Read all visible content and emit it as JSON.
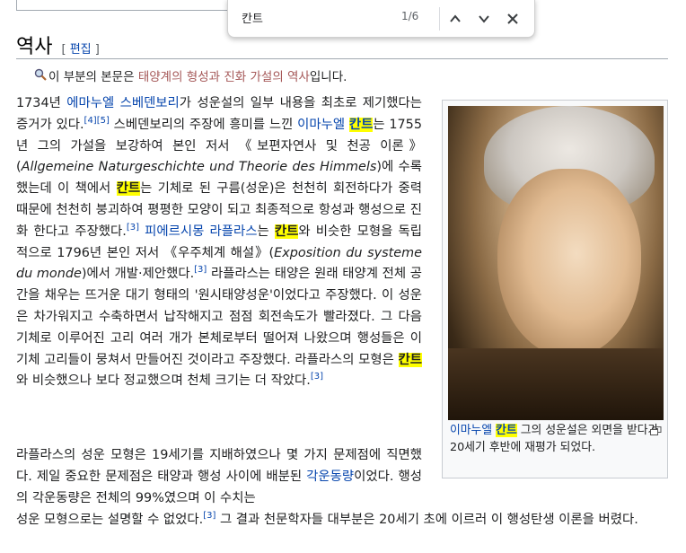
{
  "heading": {
    "title": "역사",
    "edit_open": "[ ",
    "edit_label": "편집",
    "edit_close": " ]"
  },
  "hatnote": {
    "pre": "이 부분의 본문은 ",
    "link": "태양계의 형성과 진화 가설의 역사",
    "post": "입니다."
  },
  "find": {
    "query": "칸트",
    "count": "1/6"
  },
  "thumb": {
    "cap_pre": "이마누엘 ",
    "cap_hl": "칸트",
    "cap_post": " 그의 성운설은 외면을 받다가 20세기 후반에 재평가 되었다."
  },
  "p1": {
    "t1": "1734년 ",
    "l1": "에마누엘 스베덴보리",
    "t2": "가 성운설의 일부 내용을 최초로 제기했다는 증거가 있다.",
    "r1": "[4][5]",
    "t3": " 스베덴보리의 주장에 흥미를 느낀 ",
    "l2": "이마누엘 ",
    "h1": "칸트",
    "t4": "는 1755년 그의 가설을 보강하여 본인 저서 《보편자연사 및 천공 이론》(",
    "e1": "Allgemeine Naturgeschichte und Theorie des Himmels",
    "t5": ")에 수록했는데 이 책에서 ",
    "h2": "칸트",
    "t6": "는 기체로 된 구름(성운)은 천천히 회전하다가 중력 때문에 천천히 붕괴하여 평평한 모양이 되고 최종적으로 항성과 행성으로 진화 한다고 주장했다.",
    "r2": "[3]",
    "t7": " ",
    "l3": "피에르시몽 라플라스",
    "t8": "는 ",
    "h3": "칸트",
    "t9": "와 비슷한 모형을 독립적으로 1796년 본인 저서 《우주체계 해설》(",
    "e2": "Exposition du systeme du monde",
    "t10": ")에서 개발·제안했다.",
    "r3": "[3]",
    "t11": " 라플라스는 태양은 원래 태양계 전체 공간을 채우는 뜨거운 대기 형태의 '원시태양성운'이었다고 주장했다. 이 성운은 차가워지고 수축하면서 납작해지고 점점 회전속도가 빨라졌다. 그 다음 기체로 이루어진 고리 여러 개가 본체로부터 떨어져 나왔으며 행성들은 이 기체 고리들이 뭉쳐서 만들어진 것이라고 주장했다. 라플라스의 모형은 ",
    "h4": "칸트",
    "t12": "와 비슷했으나 보다 정교했으며 천체 크기는 더 작았다.",
    "r4": "[3]"
  },
  "p2": {
    "t1": "라플라스의 성운 모형은 19세기를 지배하였으나 몇 가지 문제점에 직면했다. 제일 중요한 문제점은 태양과 행성 사이에 배분된 ",
    "l1": "각운동량",
    "t2": "이었다. 행성의 각운동량은 전체의 99%였으며 이 수치는"
  },
  "p3": {
    "t1": "성운 모형으로는 설명할 수 없었다.",
    "r1": "[3]",
    "t2": " 그 결과 천문학자들 대부분은 20세기 초에 이르러 이 행성탄생 이론을 버렸다."
  }
}
